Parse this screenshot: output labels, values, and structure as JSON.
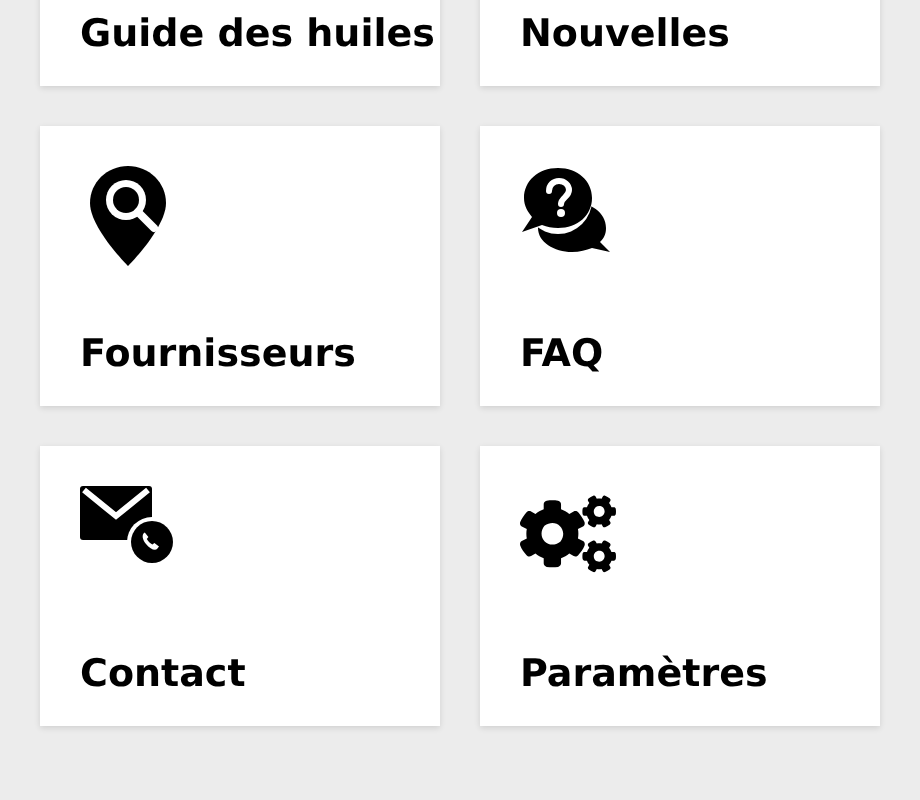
{
  "tiles": [
    {
      "label": "Guide des huiles",
      "kind": "oil"
    },
    {
      "label": "Nouvelles",
      "kind": "news"
    },
    {
      "label": "Fournisseurs",
      "kind": "supplier"
    },
    {
      "label": "FAQ",
      "kind": "faq"
    },
    {
      "label": "Contact",
      "kind": "contact"
    },
    {
      "label": "Paramètres",
      "kind": "settings"
    }
  ]
}
